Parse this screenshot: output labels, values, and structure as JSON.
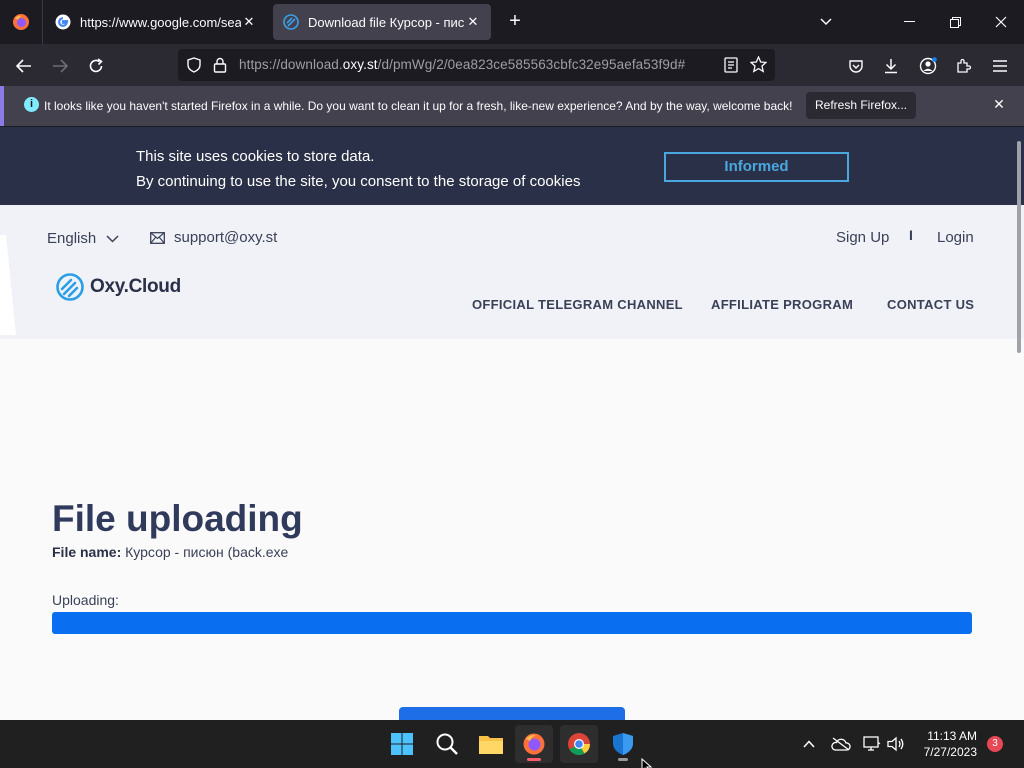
{
  "browser": {
    "tabs": [
      {
        "label": "https://www.google.com/search",
        "active": false
      },
      {
        "label": "Download file Курсор - писюн",
        "active": true
      }
    ],
    "url_prefix": "https://download.",
    "url_domain": "oxy.st",
    "url_path": "/d/pmWg/2/0ea823ce585563cbfc32e95aefa53f9d#"
  },
  "notification": {
    "text": "It looks like you haven't started Firefox in a while. Do you want to clean it up for a fresh, like-new experience? And by the way, welcome back!",
    "button": "Refresh Firefox..."
  },
  "cookie": {
    "line1": "This site uses cookies to store data.",
    "line2": "By continuing to use the site, you consent to the storage of cookies",
    "button": "Informed"
  },
  "header": {
    "language": "English",
    "support_email": "support@oxy.st",
    "signup": "Sign Up",
    "divider": "I",
    "login": "Login",
    "logo_text": "Oxy.Cloud",
    "menu": [
      "OFFICIAL TELEGRAM CHANNEL",
      "AFFILIATE PROGRAM",
      "CONTACT US"
    ]
  },
  "main": {
    "title": "File uploading",
    "file_name_label": "File name:",
    "file_name": "Курсор - писюн (back.exe",
    "uploading_label": "Uploading:",
    "progress": 1.0
  },
  "taskbar": {
    "time": "11:13 AM",
    "date": "7/27/2023",
    "notification_count": "3"
  },
  "colors": {
    "accent": "#0a6ef0",
    "cookie_bg": "#2a3047",
    "cookie_button": "#4aa7e0"
  }
}
